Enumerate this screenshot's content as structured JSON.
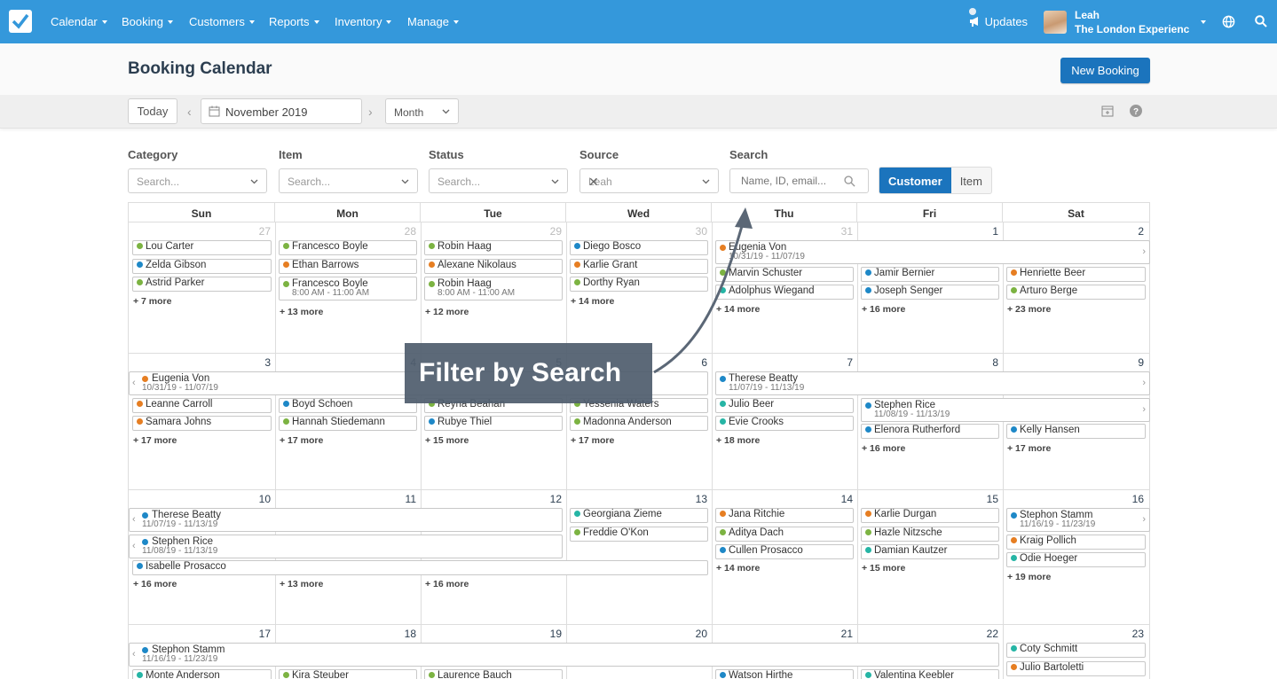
{
  "nav": {
    "items": [
      "Calendar",
      "Booking",
      "Customers",
      "Reports",
      "Inventory",
      "Manage"
    ],
    "updates_label": "Updates",
    "user_name": "Leah",
    "user_org": "The London Experienc..."
  },
  "header": {
    "title": "Booking Calendar",
    "new_booking_label": "New Booking"
  },
  "toolbar": {
    "today_label": "Today",
    "date_value": "November 2019",
    "view_value": "Month"
  },
  "filters": {
    "category": {
      "label": "Category",
      "placeholder": "Search..."
    },
    "item": {
      "label": "Item",
      "placeholder": "Search..."
    },
    "status": {
      "label": "Status",
      "placeholder": "Search..."
    },
    "source": {
      "label": "Source",
      "value": "Leah"
    },
    "search": {
      "label": "Search",
      "placeholder": "Name, ID, email..."
    },
    "toggle": {
      "customer": "Customer",
      "item": "Item"
    }
  },
  "calendar": {
    "weekdays": [
      "Sun",
      "Mon",
      "Tue",
      "Wed",
      "Thu",
      "Fri",
      "Sat"
    ],
    "dates": [
      [
        "27",
        "28",
        "29",
        "30",
        "31",
        "1",
        "2"
      ],
      [
        "3",
        "4",
        "5",
        "6",
        "7",
        "8",
        "9"
      ],
      [
        "10",
        "11",
        "12",
        "13",
        "14",
        "15",
        "16"
      ],
      [
        "17",
        "18",
        "19",
        "20",
        "21",
        "22",
        "23"
      ]
    ],
    "events": {
      "w0": [
        "Lou Carter",
        "Zelda Gibson",
        "Astrid Parker",
        "Francesco Boyle",
        "Ethan Barrows",
        "Francesco Boyle",
        "8:00 AM - 11:00 AM",
        "Robin Haag",
        "Alexane Nikolaus",
        "Robin Haag",
        "8:00 AM - 11:00 AM",
        "Diego Bosco",
        "Karlie Grant",
        "Dorthy Ryan",
        "Eugenia Von",
        "10/31/19 - 11/07/19",
        "Marvin Schuster",
        "Adolphus Wiegand",
        "Jamir Bernier",
        "Joseph Senger",
        "Henriette Beer",
        "Arturo Berge"
      ],
      "w1": [
        "Eugenia Von",
        "10/31/19 - 11/07/19",
        "Therese Beatty",
        "11/07/19 - 11/13/19",
        "Leanne Carroll",
        "Samara Johns",
        "Boyd Schoen",
        "Hannah Stiedemann",
        "Reyna Beahan",
        "Rubye Thiel",
        "Yessenia Waters",
        "Madonna Anderson",
        "Julio Beer",
        "Evie Crooks",
        "Stephen Rice",
        "11/08/19 - 11/13/19",
        "Elenora Rutherford",
        "Kelly Hansen"
      ],
      "w2": [
        "Therese Beatty",
        "11/07/19 - 11/13/19",
        "Stephen Rice",
        "11/08/19 - 11/13/19",
        "Isabelle Prosacco",
        "Georgiana Zieme",
        "Freddie O'Kon",
        "Jana Ritchie",
        "Aditya Dach",
        "Cullen Prosacco",
        "Karlie Durgan",
        "Hazle Nitzsche",
        "Damian Kautzer",
        "Stephon Stamm",
        "11/16/19 - 11/23/19",
        "Kraig Pollich",
        "Odie Hoeger"
      ],
      "w3": [
        "Stephon Stamm",
        "11/16/19 - 11/23/19",
        "Coty Schmitt",
        "Julio Bartoletti",
        "Monte Anderson",
        "Kira Steuber",
        "Laurence Bauch",
        "Watson Hirthe",
        "Valentina Keebler"
      ]
    },
    "more": {
      "w0": [
        "+ 7 more",
        "+ 13 more",
        "+ 12 more",
        "+ 14 more",
        "+ 14 more",
        "+ 16 more",
        "+ 23 more"
      ],
      "w1": [
        "+ 17 more",
        "+ 17 more",
        "+ 15 more",
        "+ 17 more",
        "+ 18 more",
        "+ 16 more",
        "+ 17 more"
      ],
      "w2": [
        "+ 16 more",
        "+ 13 more",
        "+ 16 more",
        "+ 14 more",
        "+ 15 more",
        "+ 19 more"
      ]
    }
  },
  "tooltip": {
    "text": "Filter by Search"
  },
  "colors": {
    "nav": "#3498db",
    "primary": "#1b74bd",
    "green": "#7cb342",
    "blue": "#1e88c7",
    "orange": "#e67e22",
    "teal": "#26b5a5"
  }
}
